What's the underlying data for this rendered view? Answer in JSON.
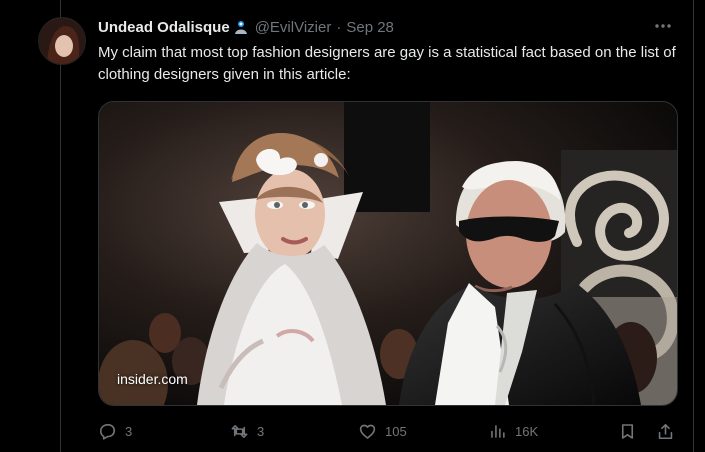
{
  "tweet": {
    "display_name": "Undead Odalisque",
    "handle": "@EvilVizier",
    "date": "Sep 28",
    "text": "My claim that most top fashion designers are gay is a statistical fact based on the list of clothing designers given in this article:",
    "media_source": "insider.com"
  },
  "actions": {
    "replies": "3",
    "retweets": "3",
    "likes": "105",
    "views": "16K"
  },
  "colors": {
    "background": "#000000",
    "text_primary": "#e7e9ea",
    "text_secondary": "#71767b",
    "border": "#2f3336"
  }
}
